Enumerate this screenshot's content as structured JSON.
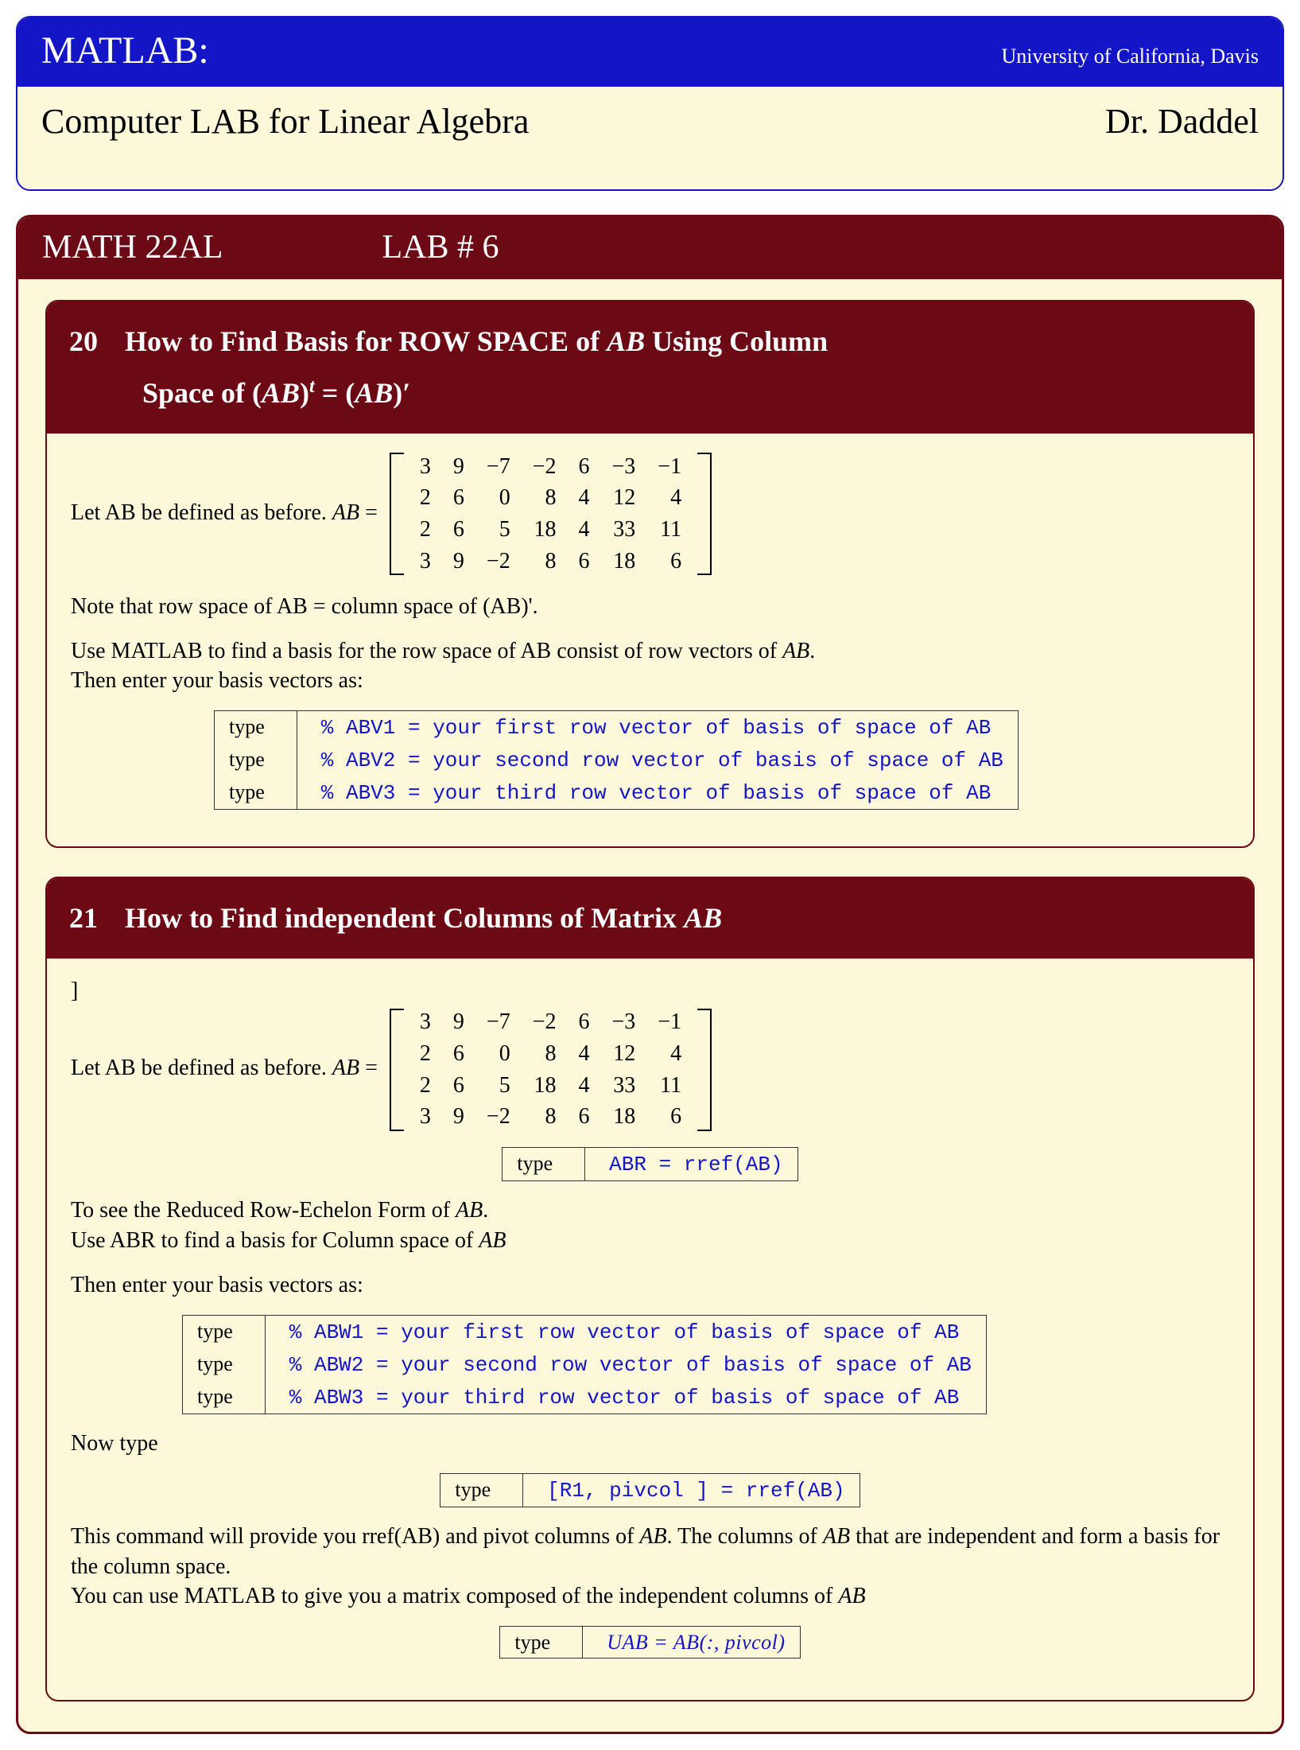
{
  "header": {
    "title": "MATLAB:",
    "university": "University of California, Davis",
    "subtitle": "Computer LAB for Linear Algebra",
    "author": "Dr. Daddel"
  },
  "course": {
    "code": "MATH 22AL",
    "lab": "LAB # 6"
  },
  "matrix_AB": [
    [
      "3",
      "9",
      "−7",
      "−2",
      "6",
      "−3",
      "−1"
    ],
    [
      "2",
      "6",
      "0",
      "8",
      "4",
      "12",
      "4"
    ],
    [
      "2",
      "6",
      "5",
      "18",
      "4",
      "33",
      "11"
    ],
    [
      "3",
      "9",
      "−2",
      "8",
      "6",
      "18",
      "6"
    ]
  ],
  "section20": {
    "num": "20",
    "title_a": "How to Find Basis for ROW SPACE of ",
    "title_ab": "AB",
    "title_b": " Using Column",
    "title_line2_a": "Space of (",
    "title_line2_ab1": "AB",
    "title_line2_mid": ")",
    "title_line2_sup": "t",
    "title_line2_eq": " = (",
    "title_line2_ab2": "AB",
    "title_line2_end": ")′",
    "intro_a": "Let AB be defined as before. ",
    "intro_ab": "AB",
    "intro_eq": " = ",
    "note": "Note that row space of AB = column space of (AB)'.",
    "use_a": "Use MATLAB to find a basis for the row space of AB consist of row vectors of ",
    "use_ab": "AB",
    "use_end": ".",
    "then": "Then enter your basis vectors as:",
    "code": [
      {
        "l": "type",
        "r": "% ABV1 = your first row vector of basis of space of AB"
      },
      {
        "l": "type",
        "r": "% ABV2 = your second row vector of basis of space of AB"
      },
      {
        "l": "type",
        "r": "% ABV3 = your third row vector of basis of space of AB"
      }
    ]
  },
  "section21": {
    "num": "21",
    "title_a": "How to Find independent Columns of Matrix ",
    "title_ab": "AB",
    "stray": "]",
    "intro_a": "Let AB be defined as before. ",
    "intro_ab": "AB",
    "intro_eq": " = ",
    "code_rref": {
      "l": "type",
      "r": "ABR = rref(AB)"
    },
    "para1_a": "To see the Reduced Row-Echelon Form of ",
    "para1_ab": "AB",
    "para1_end": ".",
    "para2_a": "Use ABR to find a basis for Column space of ",
    "para2_ab": "AB",
    "then": "Then enter your basis vectors as:",
    "code_abw": [
      {
        "l": "type",
        "r": "% ABW1 = your first row vector of basis of space of AB"
      },
      {
        "l": "type",
        "r": "% ABW2 = your second row vector of basis of space of AB"
      },
      {
        "l": "type",
        "r": "% ABW3 = your third row vector of basis of space of AB"
      }
    ],
    "now": "Now type",
    "code_piv": {
      "l": "type",
      "r": "[R1, pivcol ] = rref(AB)"
    },
    "para3_a": "This command will provide you rref(AB) and pivot columns of ",
    "para3_ab": "AB",
    "para3_b": ". The columns of ",
    "para3_ab2": "AB",
    "para3_c": " that are independent and form a basis for the column space.",
    "para4_a": "You can use MATLAB to give you a matrix composed of the independent columns of ",
    "para4_ab": "AB",
    "code_uab": {
      "l": "type",
      "r": "UAB = AB(:, pivcol)"
    }
  }
}
